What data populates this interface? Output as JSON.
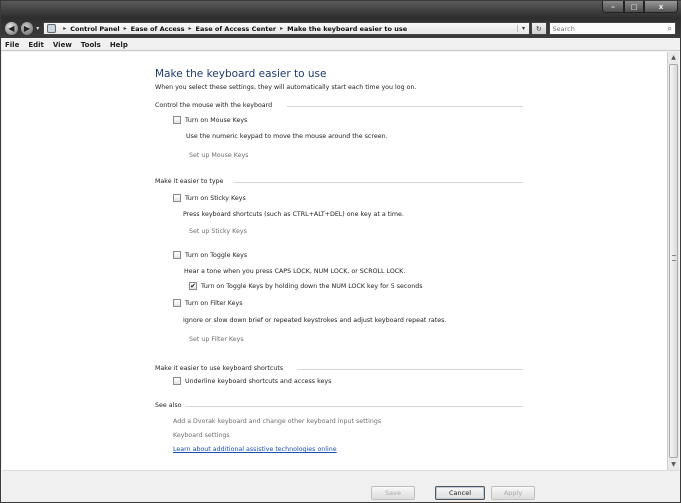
{
  "window": {
    "controls": {
      "minimize": "–",
      "maximize": "□",
      "close": "x"
    }
  },
  "navigation": {
    "back_glyph": "◀",
    "forward_glyph": "▶",
    "recent_glyph": "▾",
    "breadcrumbs": [
      "Control Panel",
      "Ease of Access",
      "Ease of Access Center",
      "Make the keyboard easier to use"
    ],
    "breadcrumb_separator": "▸",
    "dropdown_glyph": "▾",
    "refresh_glyph": "↻",
    "search_placeholder": "Search",
    "search_glyph": "⌕"
  },
  "menu": [
    "File",
    "Edit",
    "View",
    "Tools",
    "Help"
  ],
  "page": {
    "title": "Make the keyboard easier to use",
    "subtitle": "When you select these settings, they will automatically start each time you log on."
  },
  "groups": {
    "mouse": {
      "title": "Control the mouse with the keyboard",
      "mouse_keys": {
        "label": "Turn on Mouse Keys",
        "checked": false
      },
      "mouse_keys_desc": "Use the numeric keypad to move the mouse around the screen.",
      "mouse_keys_link": "Set up Mouse Keys"
    },
    "typing": {
      "title": "Make it easier to type",
      "sticky_keys": {
        "label": "Turn on Sticky Keys",
        "checked": false
      },
      "sticky_keys_desc": "Press keyboard shortcuts (such as CTRL+ALT+DEL) one key at a time.",
      "sticky_keys_link": "Set up Sticky Keys",
      "toggle_keys": {
        "label": "Turn on Toggle Keys",
        "checked": false
      },
      "toggle_keys_desc": "Hear a tone when you press CAPS LOCK, NUM LOCK, or SCROLL LOCK.",
      "toggle_keys_hold": {
        "label": "Turn on Toggle Keys by holding down the NUM LOCK key for 5 seconds",
        "checked": true
      },
      "filter_keys": {
        "label": "Turn on Filter Keys",
        "checked": false
      },
      "filter_keys_desc": "Ignore or slow down brief or repeated keystrokes and adjust keyboard repeat rates.",
      "filter_keys_link": "Set up Filter Keys"
    },
    "shortcuts": {
      "title": "Make it easier to use keyboard shortcuts",
      "underline": {
        "label": "Underline keyboard shortcuts and access keys",
        "checked": false
      }
    },
    "see_also": {
      "title": "See also",
      "links": [
        "Add a Dvorak keyboard and change other keyboard input settings",
        "Keyboard settings",
        "Learn about additional assistive technologies online"
      ]
    }
  },
  "scrollbar": {
    "up_glyph": "▲",
    "down_glyph": "▼"
  },
  "footer": {
    "save": "Save",
    "cancel": "Cancel",
    "apply": "Apply"
  },
  "check_glyph": "✔"
}
